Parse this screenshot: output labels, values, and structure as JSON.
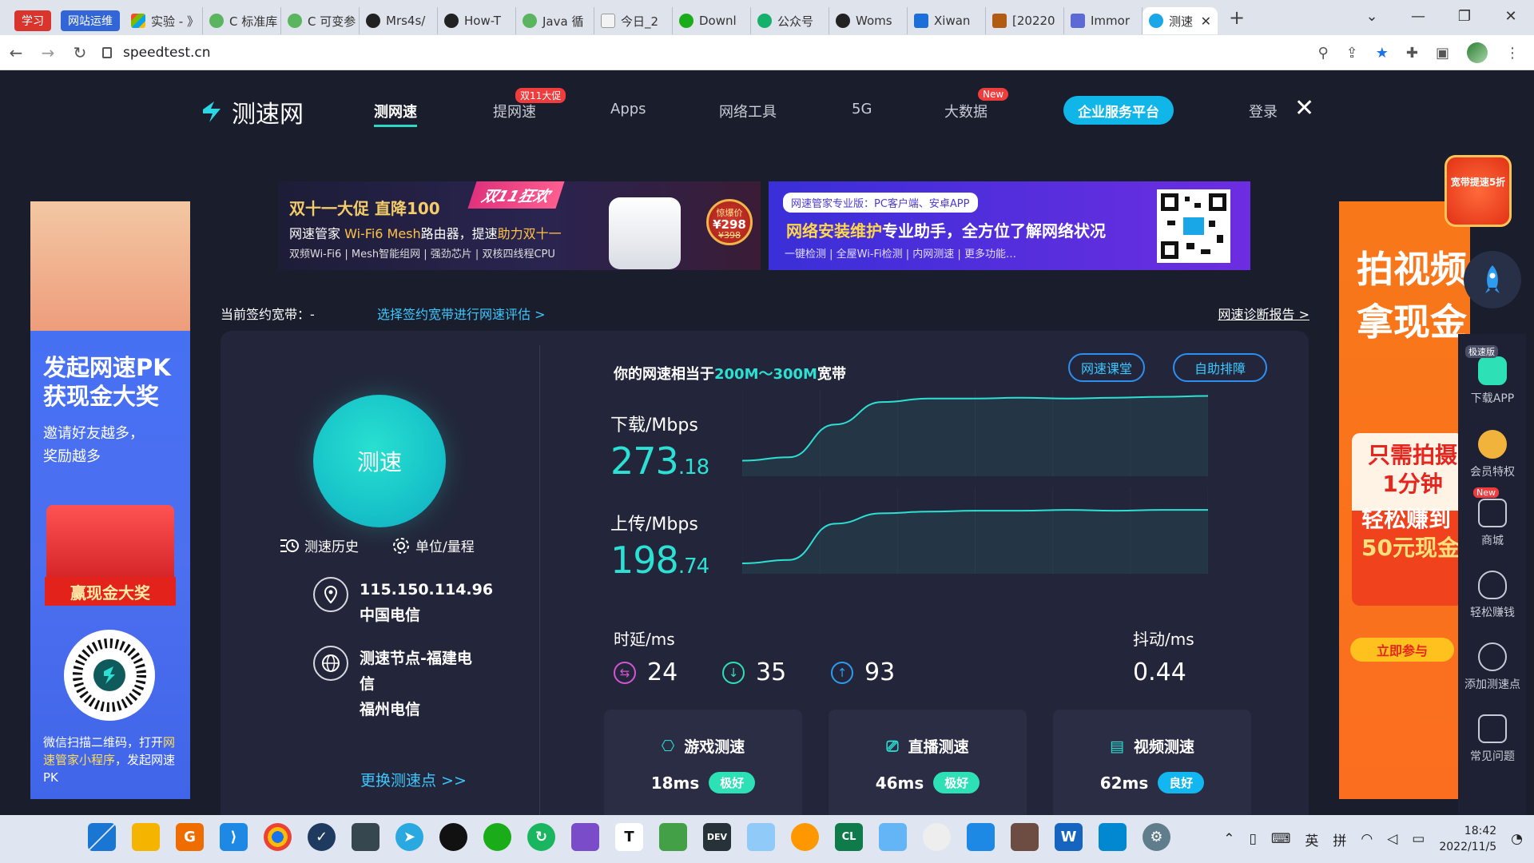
{
  "browser": {
    "tabs": [
      {
        "label": "学习",
        "pinned": true,
        "style": "red"
      },
      {
        "label": "网站运维",
        "pinned": true,
        "style": "blue"
      },
      {
        "label": "实验 - 》",
        "icon": "windows-icon"
      },
      {
        "label": "C 标准库",
        "icon": "book-icon"
      },
      {
        "label": "C 可变参",
        "icon": "book-icon"
      },
      {
        "label": "Mrs4s/",
        "icon": "github-icon"
      },
      {
        "label": "How-T",
        "icon": "github-icon"
      },
      {
        "label": "Java 循",
        "icon": "book-icon"
      },
      {
        "label": "今日_2",
        "icon": "calendar-icon"
      },
      {
        "label": "Downl",
        "icon": "wechat-icon"
      },
      {
        "label": "公众号",
        "icon": "link-icon"
      },
      {
        "label": "Woms",
        "icon": "github-icon"
      },
      {
        "label": "Xiwan",
        "icon": "fiddle-icon"
      },
      {
        "label": "[20220",
        "icon": "doc-icon"
      },
      {
        "label": "Immor",
        "icon": "app-icon"
      },
      {
        "label": "测速",
        "icon": "speedtest-icon",
        "active": true
      }
    ],
    "url": "speedtest.cn"
  },
  "nav": {
    "logo": "测速网",
    "items": [
      {
        "label": "测网速",
        "active": true
      },
      {
        "label": "提网速",
        "badge": "双11大促"
      },
      {
        "label": "Apps"
      },
      {
        "label": "网络工具"
      },
      {
        "label": "5G"
      },
      {
        "label": "大数据",
        "badge": "New"
      }
    ],
    "enterprise": "企业服务平台",
    "login": "登录"
  },
  "banner_left": {
    "tag": "双11狂欢",
    "title": "双十一大促  直降100",
    "line1_a": "网速管家 ",
    "line1_b": "Wi-Fi6 Mesh",
    "line1_c": "路由器，提速",
    "line1_d": "助力双十一",
    "line2": "双频Wi-Fi6 | Mesh智能组网 | 强劲芯片 | 双核四线程CPU",
    "price_label": "惊爆价",
    "price": "¥298",
    "old_price": "¥398"
  },
  "banner_right": {
    "pill": "网速管家专业版：PC客户端、安卓APP",
    "headline_a": "网络安装维护",
    "headline_b": "专业助手，全方位了解网络状况",
    "features": "一键检测 | 全屋Wi-Fi检测 | 内网测速 | 更多功能…"
  },
  "contract": {
    "label": "当前签约宽带：-",
    "link": "选择签约宽带进行网速评估 >",
    "report": "网速诊断报告 >"
  },
  "test": {
    "go_label": "测速",
    "history": "测速历史",
    "units": "单位/量程",
    "ip": "115.150.114.96",
    "isp": "中国电信",
    "node_line1": "测速节点-福建电",
    "node_line2": "信",
    "node_city": "福州电信",
    "change_node": "更换测速点 >>",
    "equiv_prefix": "你的网速相当于",
    "equiv_value": "200M～300M",
    "equiv_suffix": "宽带",
    "btn_class": "网速课堂",
    "btn_fix": "自助排障",
    "download_label": "下载/Mbps",
    "download_int": "273",
    "download_dec": ".18",
    "upload_label": "上传/Mbps",
    "upload_int": "198",
    "upload_dec": ".74",
    "latency_label": "时延/ms",
    "latency": "24",
    "latency_down": "35",
    "latency_up": "93",
    "jitter_label": "抖动/ms",
    "jitter": "0.44",
    "cards": [
      {
        "title": "游戏测速",
        "ms": "18ms",
        "rating": "极好",
        "color": "#2de0b6",
        "icon": "gamepad-icon"
      },
      {
        "title": "直播测速",
        "ms": "46ms",
        "rating": "极好",
        "color": "#2de0b6",
        "icon": "tv-icon"
      },
      {
        "title": "视频测速",
        "ms": "62ms",
        "rating": "良好",
        "color": "#12b6f0",
        "icon": "video-icon"
      }
    ],
    "accent": "#2de0d4",
    "download_series": [
      0.18,
      0.22,
      0.6,
      0.86,
      0.9,
      0.9,
      0.91,
      0.9,
      0.91,
      0.92,
      0.93
    ],
    "upload_series": [
      0.12,
      0.16,
      0.58,
      0.7,
      0.72,
      0.73,
      0.73,
      0.74,
      0.73,
      0.74,
      0.74
    ]
  },
  "left_ad": {
    "h1": "发起网速PK",
    "h2": "获现金大奖",
    "sub1": "邀请好友越多，",
    "sub2": "奖励越多",
    "win": "赢现金大奖",
    "foot_a": "微信扫描二维码，打开",
    "foot_b": "网速管家小程序",
    "foot_c": "，发起网速PK"
  },
  "right_ad": {
    "h1": "拍视频",
    "h2": "拿现金",
    "c1": "只需拍摄",
    "c2": "1分钟",
    "c3": "轻松赚到",
    "c4": "50元现金",
    "join": "立即参与",
    "badge": "宽带提速5折"
  },
  "rail": [
    {
      "label": "下载APP",
      "tag": "极速版",
      "icon": "android-icon"
    },
    {
      "label": "会员特权",
      "icon": "crown-icon"
    },
    {
      "label": "商城",
      "tag": "New",
      "icon": "shop-icon"
    },
    {
      "label": "轻松赚钱",
      "icon": "money-bag-icon"
    },
    {
      "label": "添加测速点",
      "icon": "network-icon"
    },
    {
      "label": "常见问题",
      "icon": "question-icon"
    }
  ],
  "tray": {
    "ime1": "英",
    "ime2": "拼",
    "time": "18:42",
    "date": "2022/11/5"
  }
}
